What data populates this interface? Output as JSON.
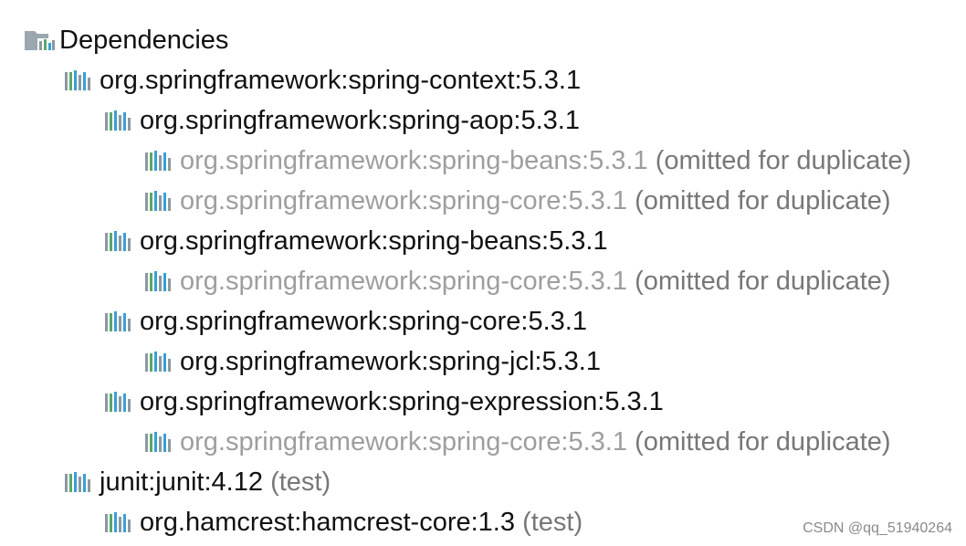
{
  "tree": {
    "root": {
      "label": "Dependencies"
    },
    "children": [
      {
        "label": "org.springframework:spring-context:5.3.1",
        "expanded": true,
        "children": [
          {
            "label": "org.springframework:spring-aop:5.3.1",
            "expanded": true,
            "children": [
              {
                "label": "org.springframework:spring-beans:5.3.1",
                "note": "(omitted for duplicate)",
                "omitted": true
              },
              {
                "label": "org.springframework:spring-core:5.3.1",
                "note": "(omitted for duplicate)",
                "omitted": true
              }
            ]
          },
          {
            "label": "org.springframework:spring-beans:5.3.1",
            "expanded": true,
            "children": [
              {
                "label": "org.springframework:spring-core:5.3.1",
                "note": "(omitted for duplicate)",
                "omitted": true
              }
            ]
          },
          {
            "label": "org.springframework:spring-core:5.3.1",
            "expanded": true,
            "children": [
              {
                "label": "org.springframework:spring-jcl:5.3.1"
              }
            ]
          },
          {
            "label": "org.springframework:spring-expression:5.3.1",
            "expanded": true,
            "children": [
              {
                "label": "org.springframework:spring-core:5.3.1",
                "note": "(omitted for duplicate)",
                "omitted": true
              }
            ]
          }
        ]
      },
      {
        "label": "junit:junit:4.12",
        "note": "(test)",
        "expanded": true,
        "children": [
          {
            "label": "org.hamcrest:hamcrest-core:1.3",
            "note": "(test)"
          }
        ]
      }
    ]
  },
  "watermark": "CSDN @qq_51940264",
  "icons": {
    "root": "maven-dependencies-folder-icon",
    "artifact": "maven-library-icon",
    "expand": "chevron-down-icon"
  },
  "colors": {
    "text": "#111111",
    "omitted_text": "#9e9e9e",
    "note_text": "#777777",
    "chevron": "#8c8c8c",
    "watermark_text": "#8a8a8a",
    "icon_gray": "#8c98a0",
    "icon_green": "#59a869",
    "icon_blue": "#389fd6"
  }
}
